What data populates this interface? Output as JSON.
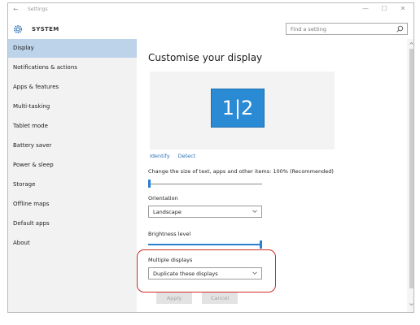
{
  "window": {
    "title": "Settings",
    "back_icon": "back-arrow-icon",
    "controls": {
      "minimize": "—",
      "maximize": "☐",
      "close": "✕"
    }
  },
  "header": {
    "section": "SYSTEM",
    "section_icon": "gear-icon",
    "search": {
      "placeholder": "Find a setting",
      "icon": "search-icon"
    }
  },
  "sidebar": {
    "items": [
      {
        "label": "Display",
        "selected": true
      },
      {
        "label": "Notifications & actions"
      },
      {
        "label": "Apps & features"
      },
      {
        "label": "Multi-tasking"
      },
      {
        "label": "Tablet mode"
      },
      {
        "label": "Battery saver"
      },
      {
        "label": "Power & sleep"
      },
      {
        "label": "Storage"
      },
      {
        "label": "Offline maps"
      },
      {
        "label": "Default apps"
      },
      {
        "label": "About"
      }
    ]
  },
  "main": {
    "heading": "Customise your display",
    "preview": {
      "monitor_label": "1|2",
      "monitor_color": "#2a8ad4"
    },
    "links": {
      "identify": "Identify",
      "detect": "Detect"
    },
    "scale": {
      "label": "Change the size of text, apps and other items: 100% (Recommended)",
      "value_fraction": 0.0
    },
    "orientation": {
      "label": "Orientation",
      "value": "Landscape"
    },
    "brightness": {
      "label": "Brightness level",
      "value_fraction": 1.0
    },
    "multiple_displays": {
      "label": "Multiple displays",
      "value": "Duplicate these displays"
    },
    "buttons": {
      "apply": "Apply",
      "cancel": "Cancel"
    },
    "highlight_color": "#cc2b2b",
    "accent_color": "#2a7fd0"
  }
}
